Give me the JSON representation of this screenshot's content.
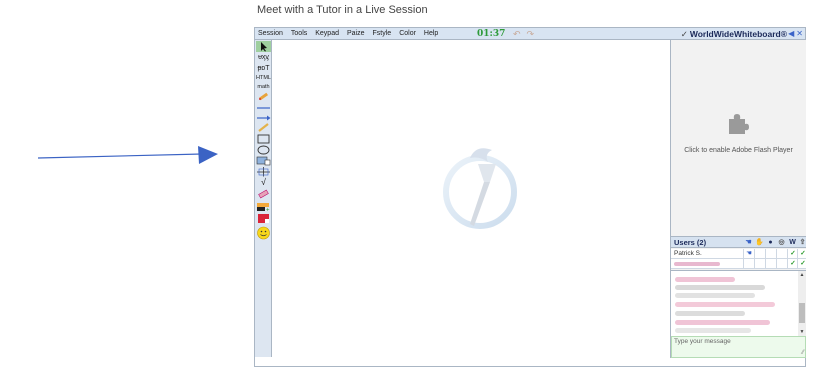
{
  "page": {
    "heading": "Meet with a Tutor in a Live Session"
  },
  "menubar": {
    "items": [
      "Session",
      "Tools",
      "Keypad",
      "Paize",
      "Fstyle",
      "Color",
      "Help"
    ],
    "timer": "01:37",
    "brand": "WorldWideWhiteboard",
    "brand_mark": "®"
  },
  "toolbar": {
    "tools": [
      {
        "name": "pointer-tool",
        "label": "",
        "icon": "arrow-pointer-icon"
      },
      {
        "name": "text-tool-1",
        "label": "ᵾᶍᶌ",
        "icon": "text-icon"
      },
      {
        "name": "text-tool-2",
        "label": "ᵽᴅT",
        "icon": "text-size-icon"
      },
      {
        "name": "html-tool",
        "label": "HTML",
        "icon": "html-icon"
      },
      {
        "name": "math-tool",
        "label": "math",
        "icon": "math-icon"
      },
      {
        "name": "pencil-tool",
        "label": "",
        "icon": "pencil-icon"
      },
      {
        "name": "line-tool",
        "label": "",
        "icon": "line-icon"
      },
      {
        "name": "arrow-line-tool",
        "label": "",
        "icon": "arrow-line-icon"
      },
      {
        "name": "highlighter-tool",
        "label": "",
        "icon": "highlighter-icon"
      },
      {
        "name": "rectangle-tool",
        "label": "",
        "icon": "rectangle-icon"
      },
      {
        "name": "ellipse-tool",
        "label": "",
        "icon": "ellipse-icon"
      },
      {
        "name": "image-tool",
        "label": "",
        "icon": "image-icon"
      },
      {
        "name": "graph-tool",
        "label": "",
        "icon": "graph-icon"
      },
      {
        "name": "sqrt-tool",
        "label": "√",
        "icon": "sqrt-icon"
      },
      {
        "name": "eraser-tool",
        "label": "",
        "icon": "eraser-icon"
      },
      {
        "name": "add-page-tool",
        "label": "",
        "icon": "add-page-icon"
      },
      {
        "name": "remove-page-tool",
        "label": "",
        "icon": "remove-page-icon"
      },
      {
        "name": "smiley-tool",
        "label": "",
        "icon": "smiley-icon"
      }
    ]
  },
  "sidepanel": {
    "flash_message": "Click to enable Adobe Flash Player",
    "users_title": "Users (2)",
    "users_columns": [
      "hand-icon",
      "hand-raised-icon",
      "mic-icon",
      "webcam-icon",
      "W",
      "export-icon"
    ],
    "users_col_w": "W",
    "users": [
      {
        "name": "Patrick S.",
        "w_check": "✓",
        "export_check": "✓"
      },
      {
        "name": "",
        "w_check": "✓",
        "export_check": "✓"
      }
    ],
    "chat_placeholder": "Type your message"
  },
  "colors": {
    "accent": "#3a63c8",
    "timer": "#2e9a3a",
    "toolbar_bg": "#dde6f1",
    "menubar_bg": "#d8e4f2",
    "chat_input_bg": "#edfaec"
  }
}
